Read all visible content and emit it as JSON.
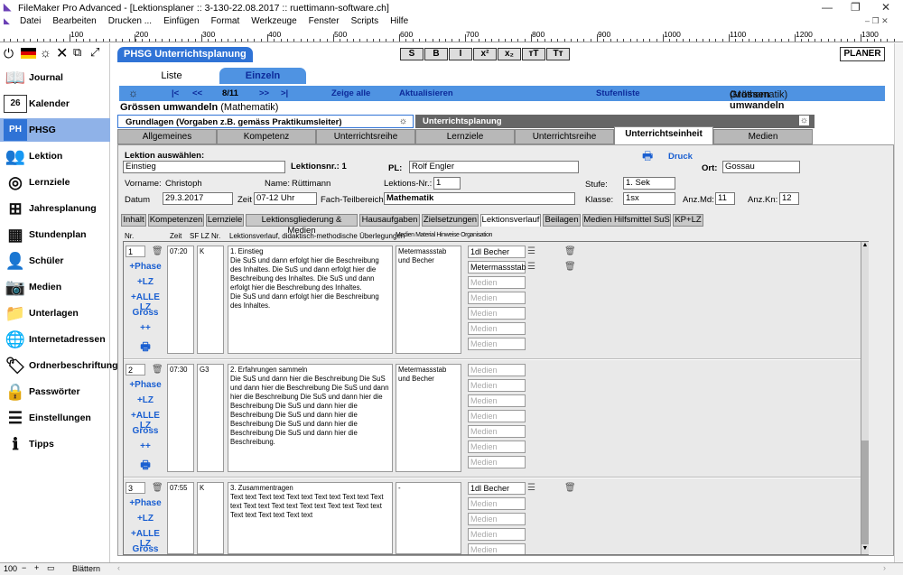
{
  "window": {
    "title": "FileMaker Pro Advanced - [Lektionsplaner :: 3-130-22.08.2017 :: ruettimann-software.ch]"
  },
  "menu": [
    "Datei",
    "Bearbeiten",
    "Drucken ...",
    "Einfügen",
    "Format",
    "Werkzeuge",
    "Fenster",
    "Scripts",
    "Hilfe"
  ],
  "ruler": [
    "100",
    "200",
    "300",
    "400",
    "500",
    "600",
    "700",
    "800",
    "900",
    "1000",
    "1100",
    "1200",
    "1300"
  ],
  "sidebar": {
    "items": [
      {
        "label": "Journal",
        "icon": "book-icon",
        "glyph": "📖"
      },
      {
        "label": "Kalender",
        "icon": "calendar-icon",
        "glyph": "26"
      },
      {
        "label": "PHSG",
        "icon": "phsg-icon",
        "glyph": "PH"
      },
      {
        "label": "Lektion",
        "icon": "lesson-icon",
        "glyph": "👥"
      },
      {
        "label": "Lernziele",
        "icon": "target-icon",
        "glyph": "◎"
      },
      {
        "label": "Jahresplanung",
        "icon": "hierarchy-icon",
        "glyph": "⊞"
      },
      {
        "label": "Stundenplan",
        "icon": "timetable-icon",
        "glyph": "▦"
      },
      {
        "label": "Schüler",
        "icon": "student-icon",
        "glyph": "👤"
      },
      {
        "label": "Medien",
        "icon": "camera-icon",
        "glyph": "📷"
      },
      {
        "label": "Unterlagen",
        "icon": "folder-icon",
        "glyph": "📁"
      },
      {
        "label": "Internetadressen",
        "icon": "globe-icon",
        "glyph": "🌐"
      },
      {
        "label": "Ordnerbeschriftung",
        "icon": "tag-icon",
        "glyph": "🏷"
      },
      {
        "label": "Passwörter",
        "icon": "lock-icon",
        "glyph": "🔒"
      },
      {
        "label": "Einstellungen",
        "icon": "sliders-icon",
        "glyph": "☰"
      },
      {
        "label": "Tipps",
        "icon": "book-info-icon",
        "glyph": "ℹ"
      }
    ]
  },
  "header": {
    "title": "PHSG Unterrichtsplanung",
    "format_buttons": [
      "S",
      "B",
      "I",
      "x²",
      "x₂",
      "ᴛT",
      "Tт"
    ],
    "logo": "PLANER"
  },
  "viewtabs": {
    "list": "Liste",
    "single": "Einzeln"
  },
  "navbar": {
    "first": "|<",
    "prev": "<<",
    "record": "8/11",
    "next": ">>",
    "last": ">|",
    "show_all": "Zeige alle",
    "refresh": "Aktualisieren",
    "levels": "Stufenliste",
    "lesson": "Grössen umwandeln",
    "subject": "(Mathematik)"
  },
  "lesson_title": {
    "name": "Grössen umwandeln",
    "subject": "(Mathematik)"
  },
  "sections": {
    "left": "Grundlagen (Vorgaben z.B. gemäss Praktikumsleiter)",
    "right": "Unterrichtsplanung"
  },
  "tabs": [
    "Allgemeines",
    "Kompetenz",
    "Unterrichtsreihe",
    "Lernziele",
    "Unterrichtsreihe",
    "Unterrichtseinheit",
    "Medien"
  ],
  "form": {
    "lektion_auswaehlen": "Lektion auswählen:",
    "lektion_value": "Einstieg",
    "lektionsnr_label": "Lektionsnr.:",
    "lektionsnr_value": "1",
    "pl_label": "PL:",
    "pl_value": "Rolf Engler",
    "druck": "Druck",
    "ort_label": "Ort:",
    "ort_value": "Gossau",
    "vorname_label": "Vorname:",
    "vorname_value": "Christoph",
    "name_label": "Name:",
    "name_value": "Rüttimann",
    "lektionsnr2_label": "Lektions-Nr.:",
    "lektionsnr2_value": "1",
    "stufe_label": "Stufe:",
    "stufe_value": "1. Sek",
    "datum_label": "Datum",
    "datum_value": "29.3.2017",
    "zeit_label": "Zeit",
    "zeit_value": "07-12 Uhr",
    "fach_label": "Fach-Teilbereich",
    "fach_value": "Mathematik",
    "klasse_label": "Klasse:",
    "klasse_value": "1sx",
    "anzmd_label": "Anz.Md:",
    "anzmd_value": "11",
    "anzkn_label": "Anz.Kn:",
    "anzkn_value": "12"
  },
  "subtabs": [
    "Inhalt",
    "Kompetenzen",
    "Lernziele",
    "Lektionsgliederung & Medien",
    "Hausaufgaben",
    "Zielsetzungen",
    "Lektionsverlauf",
    "Beilagen",
    "Medien Hilfsmittel SuS",
    "KP+LZ"
  ],
  "columns": {
    "nr": "Nr.",
    "zeit": "Zeit",
    "sf": "SF LZ Nr.",
    "verlauf": "Lektionsverlauf, didaktisch-methodische Überlegungen",
    "medien": "Medien Material Hinweise Organisation"
  },
  "row_actions": {
    "phase": "+Phase",
    "lz": "+LZ",
    "alle": "+ALLE LZ",
    "gross": "Gross",
    "plusplus": "++"
  },
  "media_placeholder": "Medien",
  "rows": [
    {
      "nr": "1",
      "zeit": "07:20",
      "sf": "K",
      "text": "1. Einstieg\nDie SuS und dann erfolgt hier die Beschreibung des Inhaltes. Die SuS und dann erfolgt hier die Beschreibung des Inhaltes. Die SuS und dann erfolgt hier die Beschreibung des Inhaltes.\nDie SuS und dann erfolgt hier die Beschreibung des Inhaltes.",
      "notes": "Metermassstab und Becher",
      "media": [
        "1dl Becher",
        "Metermassstab"
      ]
    },
    {
      "nr": "2",
      "zeit": "07:30",
      "sf": "G3",
      "text": "2. Erfahrungen sammeln\nDie SuS und dann hier die Beschreibung Die SuS und dann hier die Beschreibung Die SuS und dann hier die Beschreibung Die SuS und dann hier die Beschreibung Die SuS und dann hier die Beschreibung Die SuS und dann hier die Beschreibung Die SuS und dann hier die Beschreibung Die SuS und dann hier die Beschreibung.",
      "notes": "Metermassstab und Becher",
      "media": []
    },
    {
      "nr": "3",
      "zeit": "07:55",
      "sf": "K",
      "text": "3. Zusammentragen\nText text Text text Text text Text text Text text Text text Text text Text text Text text Text text Text text Text text Text text Text text",
      "notes": "-",
      "media": [
        "1dl Becher"
      ]
    }
  ],
  "status": {
    "zoom": "100",
    "mode": "Blättern"
  }
}
